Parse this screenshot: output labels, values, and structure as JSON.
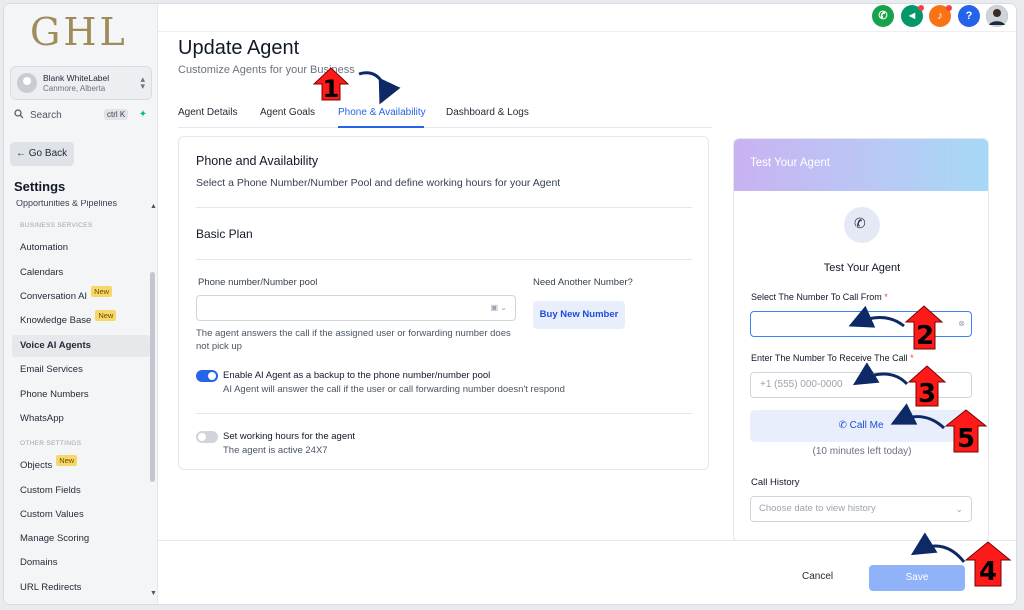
{
  "brand": {
    "logo_text": "GHL"
  },
  "account": {
    "name": "Blank WhiteLabel",
    "location": "Canmore, Alberta"
  },
  "search": {
    "label": "Search",
    "shortcut": "ctrl K"
  },
  "sidebar": {
    "go_back": "← Go Back",
    "title": "Settings",
    "cut_item": "Opportunities & Pipelines",
    "section_business": "BUSINESS SERVICES",
    "section_other": "OTHER SETTINGS",
    "items": [
      {
        "label": "Automation"
      },
      {
        "label": "Calendars"
      },
      {
        "label": "Conversation AI",
        "badge": "New"
      },
      {
        "label": "Knowledge Base",
        "badge": "New"
      },
      {
        "label": "Voice AI Agents",
        "active": true
      },
      {
        "label": "Email Services"
      },
      {
        "label": "Phone Numbers"
      },
      {
        "label": "WhatsApp"
      },
      {
        "label": "Objects",
        "badge": "New"
      },
      {
        "label": "Custom Fields"
      },
      {
        "label": "Custom Values"
      },
      {
        "label": "Manage Scoring"
      },
      {
        "label": "Domains"
      },
      {
        "label": "URL Redirects"
      }
    ]
  },
  "topbar": {
    "icons": [
      "phone-icon",
      "megaphone-icon",
      "bell-icon",
      "help-icon",
      "user-avatar"
    ],
    "colors": {
      "phone": "#16a34a",
      "megaphone": "#059669",
      "bell": "#f97316",
      "help": "#2563eb"
    }
  },
  "page": {
    "title": "Update Agent",
    "subtitle": "Customize Agents for your Business",
    "tabs": [
      "Agent Details",
      "Agent Goals",
      "Phone & Availability",
      "Dashboard & Logs"
    ],
    "active_tab": "Phone & Availability"
  },
  "phone_card": {
    "heading": "Phone and Availability",
    "description": "Select a Phone Number/Number Pool and define working hours for your Agent",
    "plan": "Basic Plan",
    "field_label": "Phone number/Number pool",
    "need_label": "Need Another Number?",
    "buy_button": "Buy New Number",
    "help_text": "The agent answers the call if the assigned user or forwarding number does not pick up",
    "backup_label": "Enable AI Agent as a backup to the phone number/number pool",
    "backup_desc": "AI Agent will answer the call if the user or call forwarding number doesn't respond",
    "backup_enabled": true,
    "hours_label": "Set working hours for the agent",
    "hours_desc": "The agent is active 24X7",
    "hours_enabled": false
  },
  "test_panel": {
    "header": "Test Your Agent",
    "title": "Test Your Agent",
    "from_label": "Select The Number To Call From",
    "to_label": "Enter The Number To Receive The Call",
    "to_placeholder": "+1 (555) 000-0000",
    "call_button": "Call Me",
    "minutes_left": "(10 minutes left today)",
    "history_label": "Call History",
    "history_placeholder": "Choose date to view history",
    "required_mark": "*"
  },
  "footer": {
    "cancel": "Cancel",
    "save": "Save"
  },
  "annotations": {
    "step_numbers": [
      "1",
      "2",
      "3",
      "4",
      "5"
    ],
    "arrow_color": "#ff1a1a",
    "pointer_color": "#0d2a66"
  }
}
